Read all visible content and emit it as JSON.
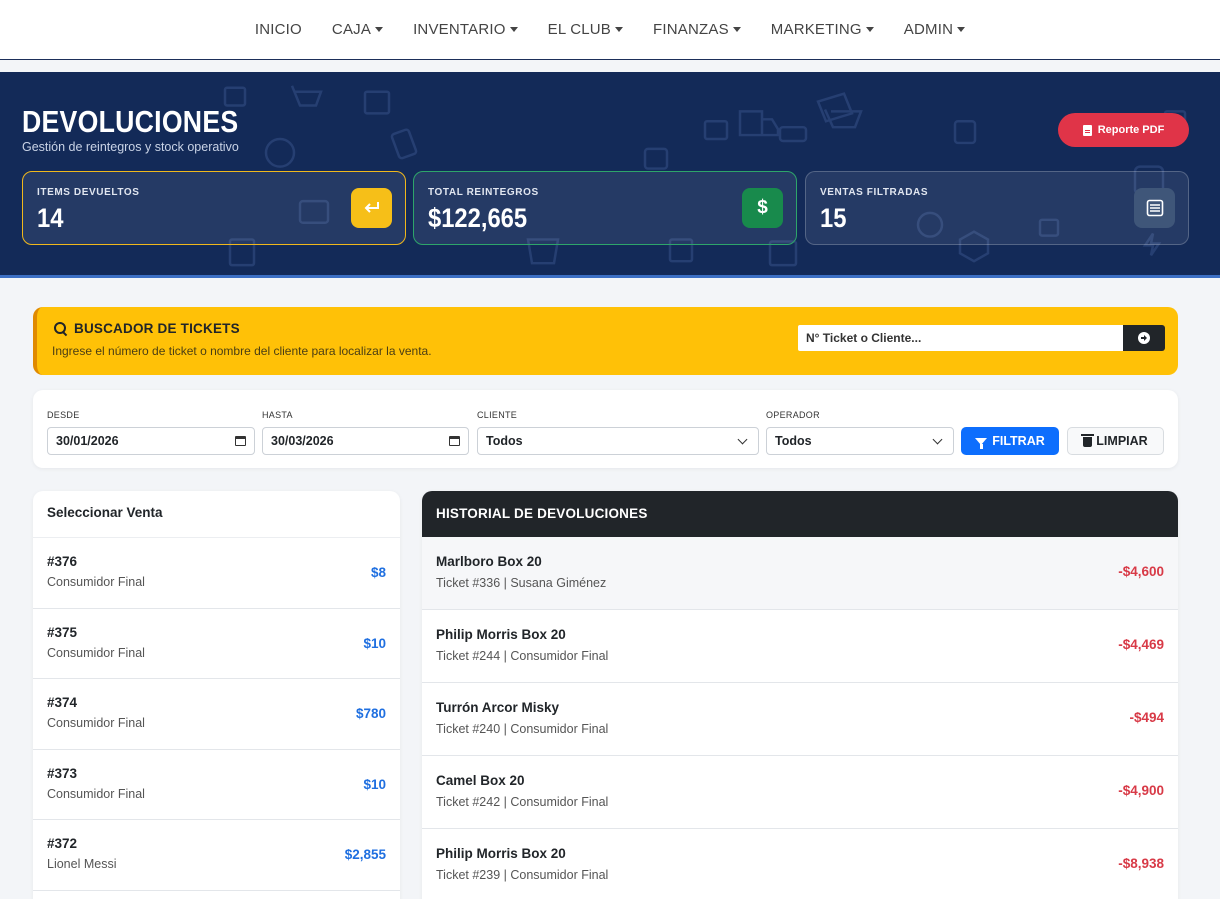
{
  "nav": [
    {
      "label": "INICIO",
      "dropdown": false
    },
    {
      "label": "CAJA",
      "dropdown": true
    },
    {
      "label": "INVENTARIO",
      "dropdown": true
    },
    {
      "label": "EL CLUB",
      "dropdown": true
    },
    {
      "label": "FINANZAS",
      "dropdown": true
    },
    {
      "label": "MARKETING",
      "dropdown": true
    },
    {
      "label": "ADMIN",
      "dropdown": true
    }
  ],
  "header": {
    "title": "DEVOLUCIONES",
    "subtitle": "Gestión de reintegros y stock operativo",
    "pdf_button": "Reporte PDF"
  },
  "stats": [
    {
      "label": "ITEMS DEVUELTOS",
      "value": "14",
      "icon": "return-arrow-icon",
      "color": "#f6bf18"
    },
    {
      "label": "TOTAL REINTEGROS",
      "value": "$122,665",
      "icon": "dollar-icon",
      "color": "#188a4c"
    },
    {
      "label": "VENTAS FILTRADAS",
      "value": "15",
      "icon": "receipt-icon",
      "color": "#3f5679"
    }
  ],
  "search": {
    "title": "BUSCADOR DE TICKETS",
    "subtitle": "Ingrese el número de ticket o nombre del cliente para localizar la venta.",
    "placeholder": "N° Ticket o Cliente..."
  },
  "filters": {
    "desde_label": "DESDE",
    "desde_value": "30/01/2026",
    "hasta_label": "HASTA",
    "hasta_value": "30/03/2026",
    "cliente_label": "CLIENTE",
    "cliente_value": "Todos",
    "operador_label": "OPERADOR",
    "operador_value": "Todos",
    "filtrar_label": "FILTRAR",
    "limpiar_label": "LIMPIAR"
  },
  "sales": {
    "title": "Seleccionar Venta",
    "items": [
      {
        "num": "#376",
        "client": "Consumidor Final",
        "amount": "$8"
      },
      {
        "num": "#375",
        "client": "Consumidor Final",
        "amount": "$10"
      },
      {
        "num": "#374",
        "client": "Consumidor Final",
        "amount": "$780"
      },
      {
        "num": "#373",
        "client": "Consumidor Final",
        "amount": "$10"
      },
      {
        "num": "#372",
        "client": "Lionel Messi",
        "amount": "$2,855"
      }
    ]
  },
  "history": {
    "title": "HISTORIAL DE DEVOLUCIONES",
    "items": [
      {
        "product": "Marlboro Box 20",
        "meta": "Ticket #336 | Susana Giménez",
        "amount": "-$4,600"
      },
      {
        "product": "Philip Morris Box 20",
        "meta": "Ticket #244 | Consumidor Final",
        "amount": "-$4,469"
      },
      {
        "product": "Turrón Arcor Misky",
        "meta": "Ticket #240 | Consumidor Final",
        "amount": "-$494"
      },
      {
        "product": "Camel Box 20",
        "meta": "Ticket #242 | Consumidor Final",
        "amount": "-$4,900"
      },
      {
        "product": "Philip Morris Box 20",
        "meta": "Ticket #239 | Consumidor Final",
        "amount": "-$8,938"
      }
    ]
  }
}
